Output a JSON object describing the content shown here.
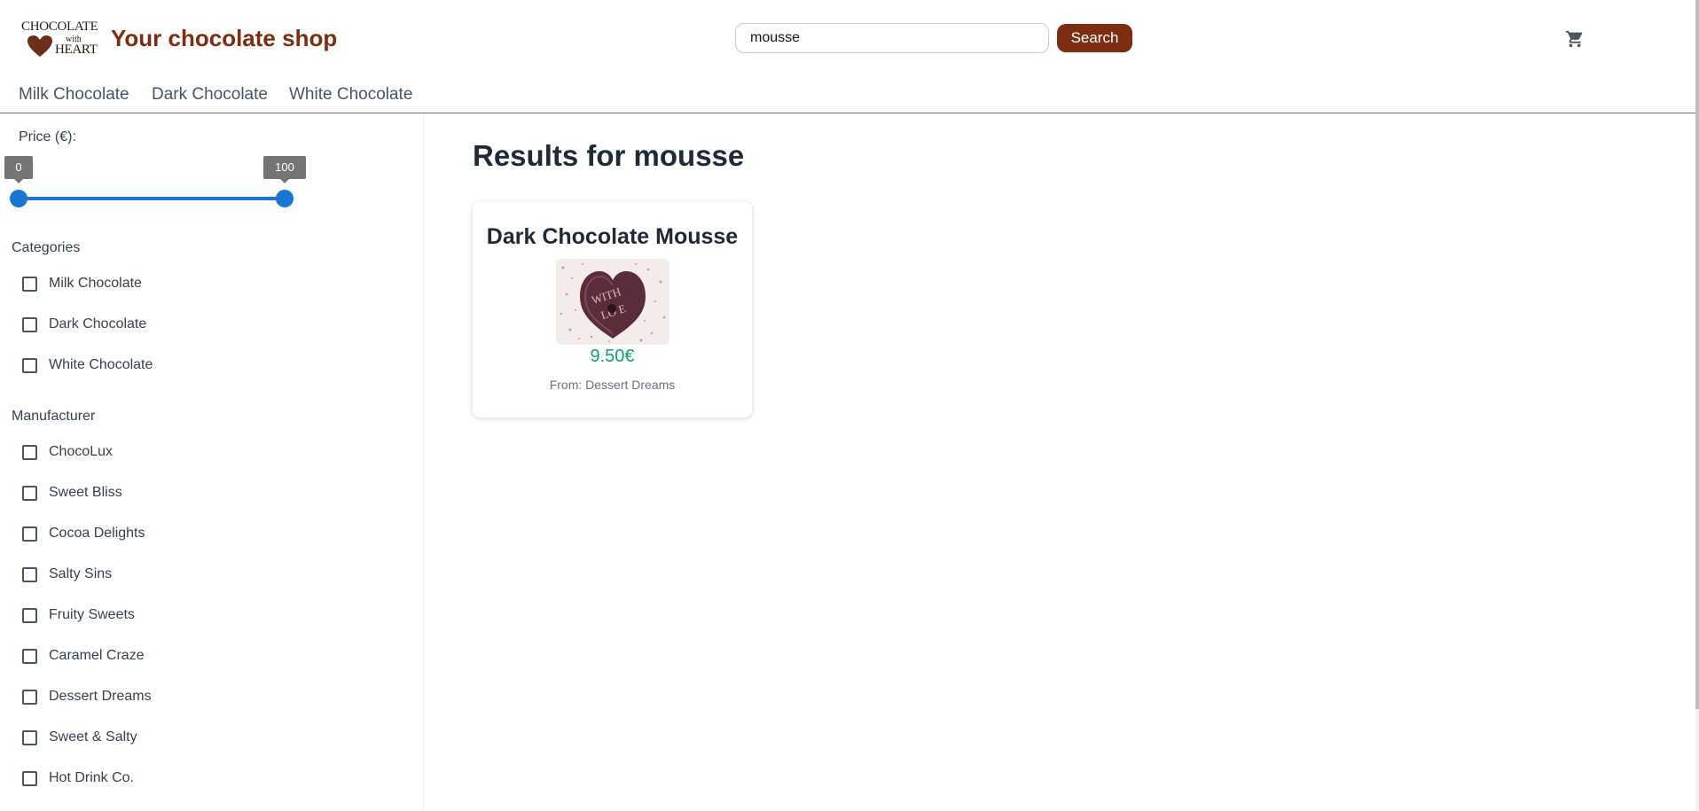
{
  "header": {
    "logo": {
      "line1": "CHOCOLATE",
      "line2": "with",
      "line3": "HEART"
    },
    "title": "Your chocolate shop",
    "search": {
      "value": "mousse",
      "placeholder": "",
      "button_label": "Search"
    },
    "cart_icon": "cart-icon"
  },
  "nav": {
    "items": [
      {
        "label": "Milk Chocolate"
      },
      {
        "label": "Dark Chocolate"
      },
      {
        "label": "White Chocolate"
      }
    ]
  },
  "sidebar": {
    "price": {
      "label": "Price (€):",
      "min": "0",
      "max": "100"
    },
    "categories": {
      "heading": "Categories",
      "items": [
        "Milk Chocolate",
        "Dark Chocolate",
        "White Chocolate"
      ]
    },
    "manufacturer": {
      "heading": "Manufacturer",
      "items": [
        "ChocoLux",
        "Sweet Bliss",
        "Cocoa Delights",
        "Salty Sins",
        "Fruity Sweets",
        "Caramel Craze",
        "Dessert Dreams",
        "Sweet & Salty",
        "Hot Drink Co."
      ]
    }
  },
  "main": {
    "results_title": "Results for mousse",
    "products": [
      {
        "name": "Dark Chocolate Mousse",
        "price": "9.50€",
        "from": "From: Dessert Dreams",
        "image_text": "WITH LOVE"
      }
    ]
  },
  "colors": {
    "brand": "#7c2d12",
    "accent": "#1976d2",
    "price": "#0f9d7a"
  }
}
